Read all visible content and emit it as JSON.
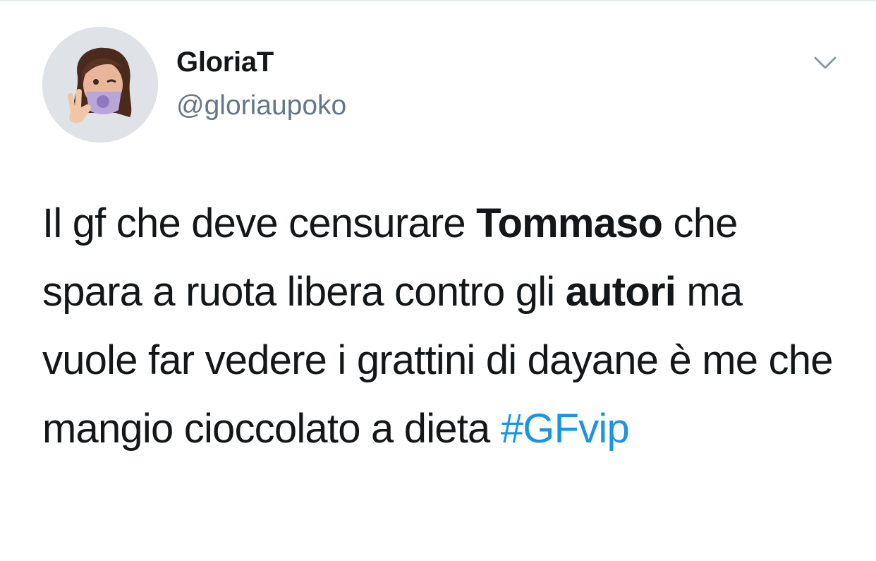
{
  "user": {
    "display_name": "GloriaT",
    "handle": "@gloriaupoko",
    "avatar_icon": "memoji-avatar-icon"
  },
  "menu": {
    "icon": "chevron-down-icon"
  },
  "tweet": {
    "seg1": "Il gf che deve censurare ",
    "bold1": "Tommaso",
    "seg2": " che spara a ruota libera contro gli ",
    "bold2": "autori",
    "seg3": " ma vuole far vedere i grattini di dayane è me che mangio cioccolato a dieta ",
    "hashtag": "#GFvip"
  },
  "colors": {
    "text": "#14171a",
    "secondary": "#657786",
    "link": "#1b95e0",
    "divider": "#e6ecf0"
  }
}
